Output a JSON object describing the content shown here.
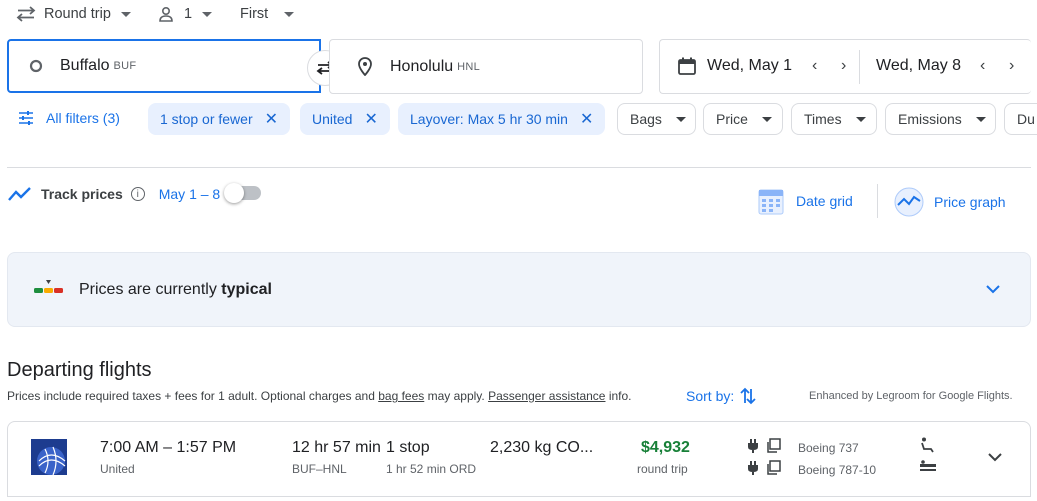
{
  "top": {
    "trip_type": "Round trip",
    "passengers": "1",
    "cabin": "First"
  },
  "search": {
    "origin_city": "Buffalo",
    "origin_code": "BUF",
    "dest_city": "Honolulu",
    "dest_code": "HNL",
    "depart_date": "Wed, May 1",
    "return_date": "Wed, May 8"
  },
  "filters": {
    "all_filters": "All filters (3)",
    "active": [
      "1 stop or fewer",
      "United",
      "Layover: Max 5 hr 30 min"
    ],
    "dropdowns": [
      "Bags",
      "Price",
      "Times",
      "Emissions",
      "Du"
    ]
  },
  "track": {
    "label": "Track prices",
    "dates": "May 1 – 8",
    "date_grid": "Date grid",
    "price_graph": "Price graph"
  },
  "insight": {
    "text_prefix": "Prices are currently ",
    "text_bold": "typical"
  },
  "departing": {
    "title": "Departing flights",
    "note_1": "Prices include required taxes + fees for 1 adult. Optional charges and ",
    "bag_fees": "bag fees",
    "note_2": " may apply. ",
    "assistance": "Passenger assistance",
    "note_3": " info.",
    "sort_by": "Sort by:",
    "enhanced": "Enhanced by Legroom for Google Flights."
  },
  "flight": {
    "times": "7:00 AM – 1:57 PM",
    "airline": "United",
    "duration": "12 hr 57 min",
    "route": "BUF–HNL",
    "stops": "1 stop",
    "layover": "1 hr 52 min ORD",
    "emissions": "2,230 kg CO...",
    "price": "$4,932",
    "price_type": "round trip",
    "aircraft_1": "Boeing 737",
    "aircraft_2": "Boeing 787-10"
  },
  "colors": {
    "accent": "#1a73e8",
    "chip_bg": "#e8f0fe",
    "price_green": "#188038"
  }
}
